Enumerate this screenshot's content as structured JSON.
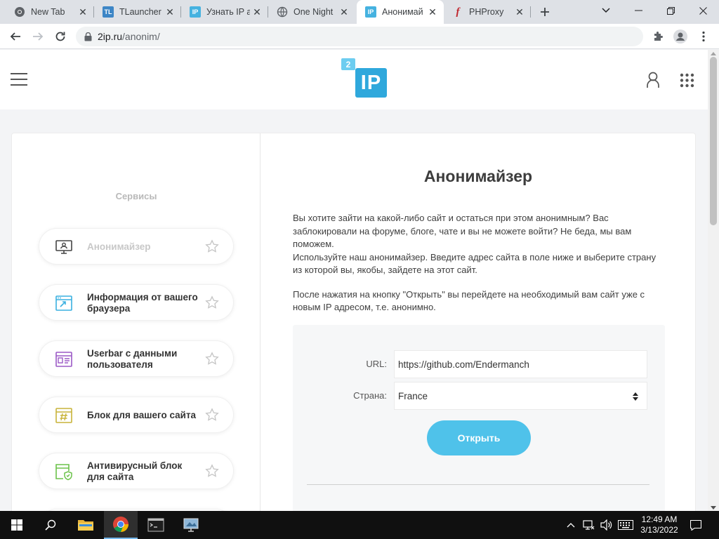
{
  "browser": {
    "tabs": [
      {
        "title": "New Tab",
        "favicon": "chrome-icon"
      },
      {
        "title": "TLauncher",
        "favicon": "tlauncher-icon",
        "badge": "TL"
      },
      {
        "title": "Узнать IP а",
        "favicon": "ip-site-icon",
        "badge": "IP"
      },
      {
        "title": "One Night",
        "favicon": "globe-icon"
      },
      {
        "title": "Анонимай",
        "favicon": "ip-site-icon",
        "badge": "IP",
        "active": true
      },
      {
        "title": "PHProxy",
        "favicon": "phproxy-icon",
        "badge": "f"
      }
    ],
    "address": {
      "host": "2ip.ru",
      "path": "/anonim/"
    }
  },
  "site": {
    "logo_badge": "2",
    "logo_text": "IP",
    "sidebar_title": "Сервисы",
    "services": [
      {
        "label": "Анонимайзер",
        "icon": "monitor-icon",
        "active": true
      },
      {
        "label": "Информация от вашего браузера",
        "icon": "browser-window-icon"
      },
      {
        "label": "Userbar с данными пользователя",
        "icon": "id-card-icon"
      },
      {
        "label": "Блок для вашего сайта",
        "icon": "hash-block-icon"
      },
      {
        "label": "Антивирусный блок для сайта",
        "icon": "shield-window-icon"
      }
    ],
    "heading": "Анонимайзер",
    "para1": "Вы хотите зайти на какой-либо сайт и остаться при этом анонимным? Вас заблокировали на форуме, блоге, чате и вы не можете войти? Не беда, мы вам поможем.",
    "para2": "Используйте наш анонимайзер. Введите адрес сайта в поле ниже и выберите страну из которой вы, якобы, зайдете на этот сайт.",
    "para3": "После нажатия на кнопку \"Открыть\" вы перейдете на необходимый вам сайт уже с новым IP адресом, т.е. анонимно.",
    "form": {
      "url_label": "URL:",
      "url_value": "https://github.com/Endermanch",
      "country_label": "Страна:",
      "country_value": "France",
      "submit_label": "Открыть"
    }
  },
  "taskbar": {
    "time": "12:49 AM",
    "date": "3/13/2022"
  },
  "colors": {
    "accent": "#4fc2ea",
    "logo": "#2fa8dc"
  }
}
